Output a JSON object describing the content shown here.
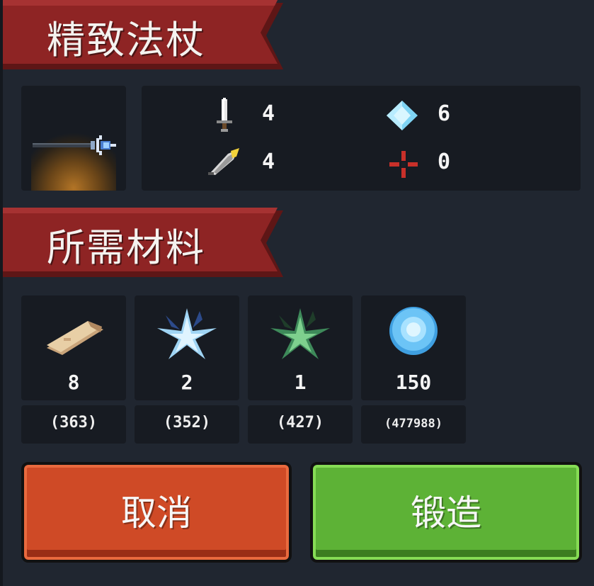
{
  "item": {
    "title": "精致法杖",
    "weapon_icon": "staff-icon",
    "stats": [
      {
        "icon": "sword-icon",
        "value": "4"
      },
      {
        "icon": "crystal-icon",
        "value": "6"
      },
      {
        "icon": "feather-icon",
        "value": "4"
      },
      {
        "icon": "crosshair-icon",
        "value": "0"
      }
    ]
  },
  "materials_section": {
    "title": "所需材料",
    "materials": [
      {
        "icon": "wood-log-icon",
        "required": "8",
        "owned": "(363)"
      },
      {
        "icon": "ice-crystal-icon",
        "required": "2",
        "owned": "(352)"
      },
      {
        "icon": "green-crystal-icon",
        "required": "1",
        "owned": "(427)"
      },
      {
        "icon": "blue-gem-icon",
        "required": "150",
        "owned": "(477988)"
      }
    ]
  },
  "actions": {
    "cancel_label": "取消",
    "forge_label": "锻造"
  },
  "colors": {
    "banner_red": "#8e2424",
    "cancel_orange": "#cf4a26",
    "forge_green": "#5db236"
  }
}
